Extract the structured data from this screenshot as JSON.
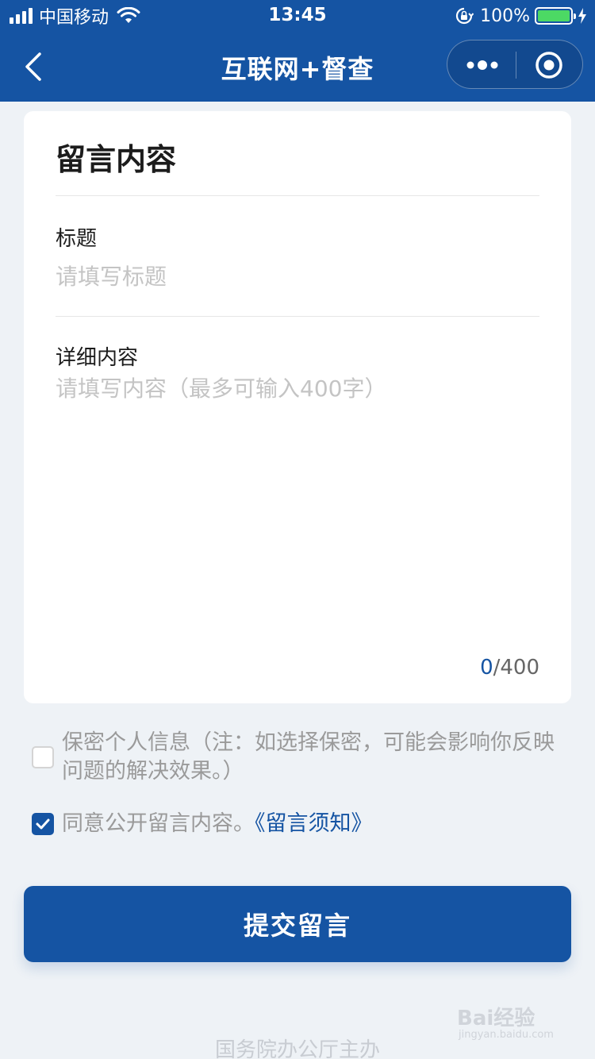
{
  "status_bar": {
    "carrier": "中国移动",
    "time": "13:45",
    "battery_percent": "100%",
    "battery_level": 1.0,
    "icons": [
      "signal-icon",
      "wifi-icon",
      "rotation-lock-icon",
      "battery-icon",
      "charging-bolt-icon"
    ]
  },
  "nav": {
    "title": "互联网+督查",
    "back_icon": "chevron-left-icon",
    "more_icon": "more-dots-icon",
    "close_icon": "target-close-icon"
  },
  "form": {
    "heading": "留言内容",
    "title_label": "标题",
    "title_placeholder": "请填写标题",
    "title_value": "",
    "content_label": "详细内容",
    "content_placeholder": "请填写内容（最多可输入400字）",
    "content_value": "",
    "counter_current": "0",
    "counter_max": "/400"
  },
  "options": {
    "privacy_text": "保密个人信息（注：如选择保密，可能会影响你反映问题的解决效果。）",
    "privacy_checked": false,
    "agree_text": "同意公开留言内容。",
    "agree_link": "《留言须知》",
    "agree_checked": true
  },
  "submit_label": "提交留言",
  "footer": "国务院办公厅主办",
  "watermark": {
    "main": "Bai经验",
    "sub": "jingyan.baidu.com"
  },
  "colors": {
    "brand": "#1554a3",
    "background": "#eef2f6",
    "battery": "#4cd964"
  }
}
